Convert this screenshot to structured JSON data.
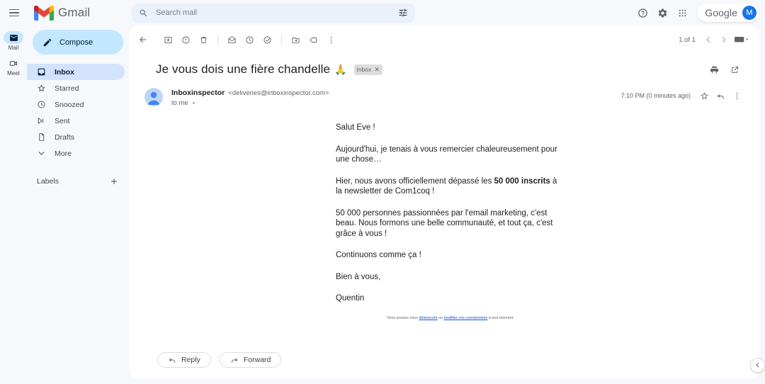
{
  "app": {
    "brand_name": "Gmail",
    "google_word": "Google",
    "account_initial": "M"
  },
  "search": {
    "placeholder": "Search mail",
    "value": ""
  },
  "rail": {
    "items": [
      {
        "label": "Mail",
        "icon": "mail-icon",
        "active": true
      },
      {
        "label": "Meet",
        "icon": "meet-icon",
        "active": false
      }
    ]
  },
  "sidebar": {
    "compose_label": "Compose",
    "nav_items": [
      {
        "label": "Inbox",
        "icon": "inbox-icon",
        "active": true
      },
      {
        "label": "Starred",
        "icon": "star-icon",
        "active": false
      },
      {
        "label": "Snoozed",
        "icon": "clock-icon",
        "active": false
      },
      {
        "label": "Sent",
        "icon": "send-icon",
        "active": false
      },
      {
        "label": "Drafts",
        "icon": "draft-icon",
        "active": false
      },
      {
        "label": "More",
        "icon": "chevron-down-icon",
        "active": false
      }
    ],
    "labels_title": "Labels",
    "labels_add_tooltip": "+"
  },
  "toolbar": {
    "back_label": "Back",
    "archive_label": "Archive",
    "report_spam_label": "Report spam",
    "delete_label": "Delete",
    "mark_unread_label": "Mark as unread",
    "snooze_label": "Snooze",
    "add_to_tasks_label": "Add to tasks",
    "move_to_label": "Move to",
    "labels_label": "Labels",
    "more_label": "More"
  },
  "pager": {
    "text": "1 of 1",
    "prev_label": "Older",
    "next_label": "Newer",
    "density_label": "Input tools"
  },
  "email": {
    "subject": "Je vous dois une fière chandelle",
    "subject_emoji": "🙏",
    "chip_label": "Inbox",
    "chip_close": "✕",
    "print_label": "Print all",
    "popout_label": "In new window",
    "sender_name": "Inboxinspector",
    "sender_email": "<deliveries@inboxinspector.com>",
    "recipient": "to me",
    "timestamp": "7:10 PM (0 minutes ago)",
    "star_label": "Star",
    "reply_icon_label": "Reply",
    "more_label": "More",
    "body_paragraphs": [
      {
        "text": "Salut Eve !"
      },
      {
        "text": "Aujourd'hui, je tenais à vous remercier chaleureusement pour une chose…"
      },
      {
        "pre": "Hier, nous avons officiellement dépassé les ",
        "bold": "50 000 inscrits",
        "post": " à la newsletter de Com1coq !"
      },
      {
        "text": "50 000 personnes passionnées par l'email marketing, c'est beau. Nous formons une belle communauté, et tout ça, c'est grâce à vous !"
      },
      {
        "text": "Continuons comme ça !"
      },
      {
        "text": "Bien à vous,"
      },
      {
        "text": "Quentin"
      }
    ],
    "footer": {
      "pre": "Vous pouvez vous ",
      "link1": "désinscrire",
      "mid": " ou ",
      "link2": "modifier vos coordonnées",
      "post": " à tout moment."
    },
    "reply_button": "Reply",
    "forward_button": "Forward"
  },
  "colors": {
    "accent": "#1a73e8",
    "compose_bg": "#c2e7ff",
    "active_nav_bg": "#d3e3fd",
    "page_bg": "#f6f8fc",
    "link": "#1155cc"
  }
}
